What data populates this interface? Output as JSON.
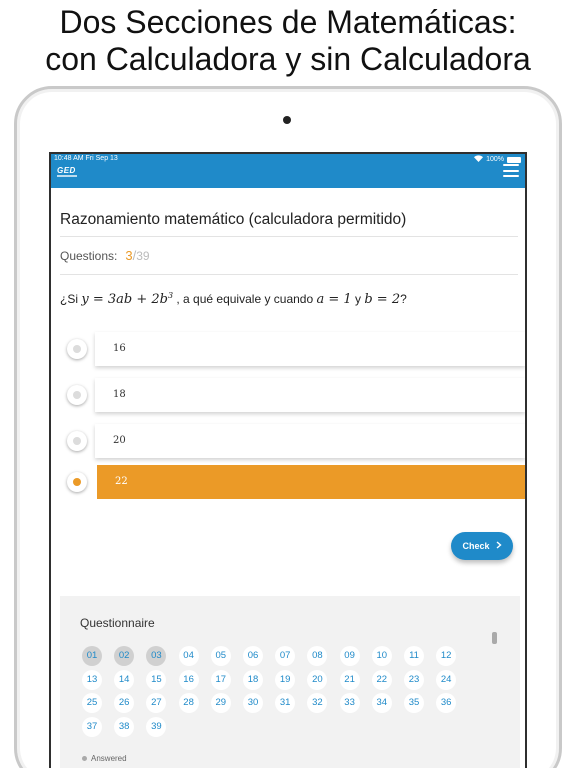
{
  "headline": {
    "line1": "Dos Secciones de Matemáticas:",
    "line2": "con Calculadora y sin Calculadora"
  },
  "status_bar": {
    "time": "10:48 AM  Fri Sep 13",
    "battery": "100%",
    "wifi_icon": "wifi-icon"
  },
  "app": {
    "logo": "GED",
    "accent_color": "#1f8ac9",
    "highlight_color": "#eb9a27"
  },
  "section": {
    "title": "Razonamiento matemático (calculadora permitido)"
  },
  "questions": {
    "label": "Questions:",
    "current": "3",
    "separator": "/",
    "total": "39"
  },
  "question": {
    "prefix": "¿Si ",
    "expr1": "y = 3ab + 2b",
    "exp": "3",
    "middle": " , a qué equivale y cuando ",
    "expr2": "a = 1",
    "and": "  y  ",
    "expr3": "b = 2",
    "suffix": "?"
  },
  "options": [
    {
      "value": "16",
      "selected": false
    },
    {
      "value": "18",
      "selected": false
    },
    {
      "value": "20",
      "selected": false
    },
    {
      "value": "22",
      "selected": true
    }
  ],
  "check_button": {
    "label": "Check",
    "icon": "chevron-right-icon"
  },
  "questionnaire": {
    "title": "Questionnaire",
    "numbers": [
      "01",
      "02",
      "03",
      "04",
      "05",
      "06",
      "07",
      "08",
      "09",
      "10",
      "11",
      "12",
      "13",
      "14",
      "15",
      "16",
      "17",
      "18",
      "19",
      "20",
      "21",
      "22",
      "23",
      "24",
      "25",
      "26",
      "27",
      "28",
      "29",
      "30",
      "31",
      "32",
      "33",
      "34",
      "35",
      "36",
      "37",
      "38",
      "39"
    ],
    "answered": [
      "01",
      "02",
      "03"
    ],
    "legend": "Answered"
  }
}
